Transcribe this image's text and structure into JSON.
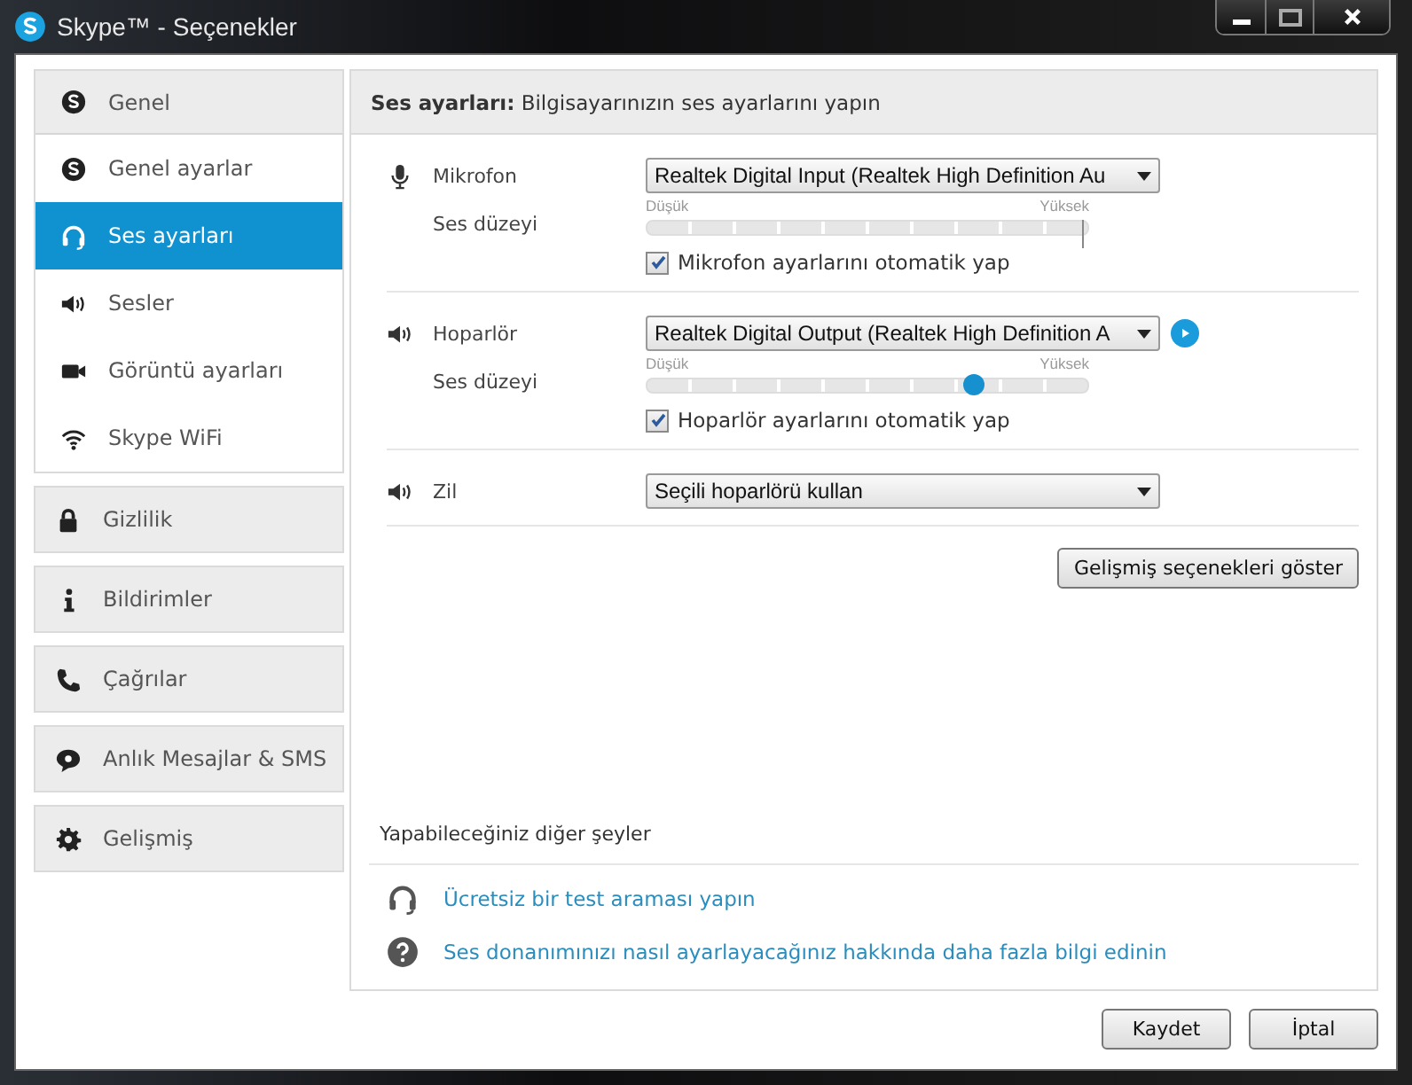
{
  "window": {
    "title": "Skype™ - Seçenekler"
  },
  "sidebar": {
    "groups": [
      {
        "label": "Genel",
        "selected": false,
        "expanded": true,
        "children": [
          {
            "label": "Genel ayarlar",
            "selected": false
          },
          {
            "label": "Ses ayarları",
            "selected": true
          },
          {
            "label": "Sesler",
            "selected": false
          },
          {
            "label": "Görüntü ayarları",
            "selected": false
          },
          {
            "label": "Skype WiFi",
            "selected": false
          }
        ]
      },
      {
        "label": "Gizlilik",
        "selected": false,
        "expanded": false
      },
      {
        "label": "Bildirimler",
        "selected": false,
        "expanded": false
      },
      {
        "label": "Çağrılar",
        "selected": false,
        "expanded": false
      },
      {
        "label": "Anlık Mesajlar & SMS",
        "selected": false,
        "expanded": false
      },
      {
        "label": "Gelişmiş",
        "selected": false,
        "expanded": false
      }
    ]
  },
  "panel": {
    "header": "**Ses ayarları:** Bilgisayarınızın ses ayarlarını yapın",
    "devices": [
      {
        "kind": "meter",
        "label": "Mikrofon",
        "device": "Realtek Digital Input (Realtek High Definition Au",
        "level_label": "Ses düzeyi",
        "low": "Düşük",
        "high": "Yüksek",
        "level": 1,
        "auto": {
          "label": "Mikrofon ayarlarını otomatik yap",
          "checked": true
        }
      },
      {
        "kind": "slider",
        "label": "Hoparlör",
        "device": "Realtek Digital Output (Realtek High Definition A",
        "play_button": true,
        "level_label": "Ses düzeyi",
        "low": "Düşük",
        "high": "Yüksek",
        "level": 0.74,
        "auto": {
          "label": "Hoparlör ayarlarını otomatik yap",
          "checked": true
        }
      },
      {
        "kind": "plain",
        "label": "Zil",
        "device": "Seçili hoparlörü kullan"
      }
    ],
    "advanced_button": "Gelişmiş seçenekleri göster",
    "more": {
      "title": "Yapabileceğiniz diğer şeyler",
      "links": [
        {
          "text": "Ücretsiz bir test araması yapın"
        },
        {
          "text": "Ses donanımınızı nasıl ayarlayacağınız hakkında daha fazla bilgi edinin"
        }
      ]
    }
  },
  "buttons": [
    "Kaydet",
    "İptal"
  ]
}
